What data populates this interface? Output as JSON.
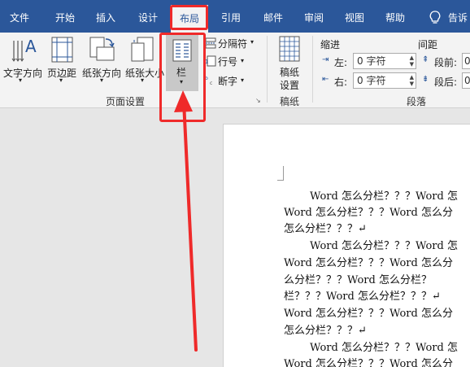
{
  "tabs": [
    "文件",
    "开始",
    "插入",
    "设计",
    "布局",
    "引用",
    "邮件",
    "审阅",
    "视图",
    "帮助"
  ],
  "tell_me": "告诉",
  "page_setup": {
    "text_direction": "文字方向",
    "margins": "页边距",
    "orientation": "纸张方向",
    "size": "纸张大小",
    "columns": "栏",
    "breaks": "分隔符",
    "line_numbers": "行号",
    "hyphenation": "断字",
    "group_label": "页面设置"
  },
  "manuscript": {
    "label1": "稿纸",
    "label2": "设置",
    "group_label": "稿纸"
  },
  "paragraph": {
    "indent_title": "缩进",
    "spacing_title": "间距",
    "left_label": "左:",
    "right_label": "右:",
    "left_value": "0 字符",
    "right_value": "0 字符",
    "before_label": "段前:",
    "after_label": "段后:",
    "before_value": "0",
    "after_value": "0",
    "group_label": "段落"
  },
  "document_lines": [
    "Word 怎么分栏？？？Word 怎",
    "Word 怎么分栏？？？Word 怎么分",
    "怎么分栏？？？↵",
    "Word 怎么分栏？？？Word 怎",
    "Word 怎么分栏？？？Word 怎么分",
    "么分栏？？？Word 怎么分栏？",
    "栏？？？Word 怎么分栏？？？↵",
    "Word 怎么分栏？？？Word 怎么分",
    "怎么分栏？？？↵",
    "Word 怎么分栏？？？Word 怎",
    "Word 怎么分栏？？？Word 怎么分"
  ],
  "colors": {
    "tab_bar": "#2b579a",
    "highlight": "#ef2a2a"
  }
}
